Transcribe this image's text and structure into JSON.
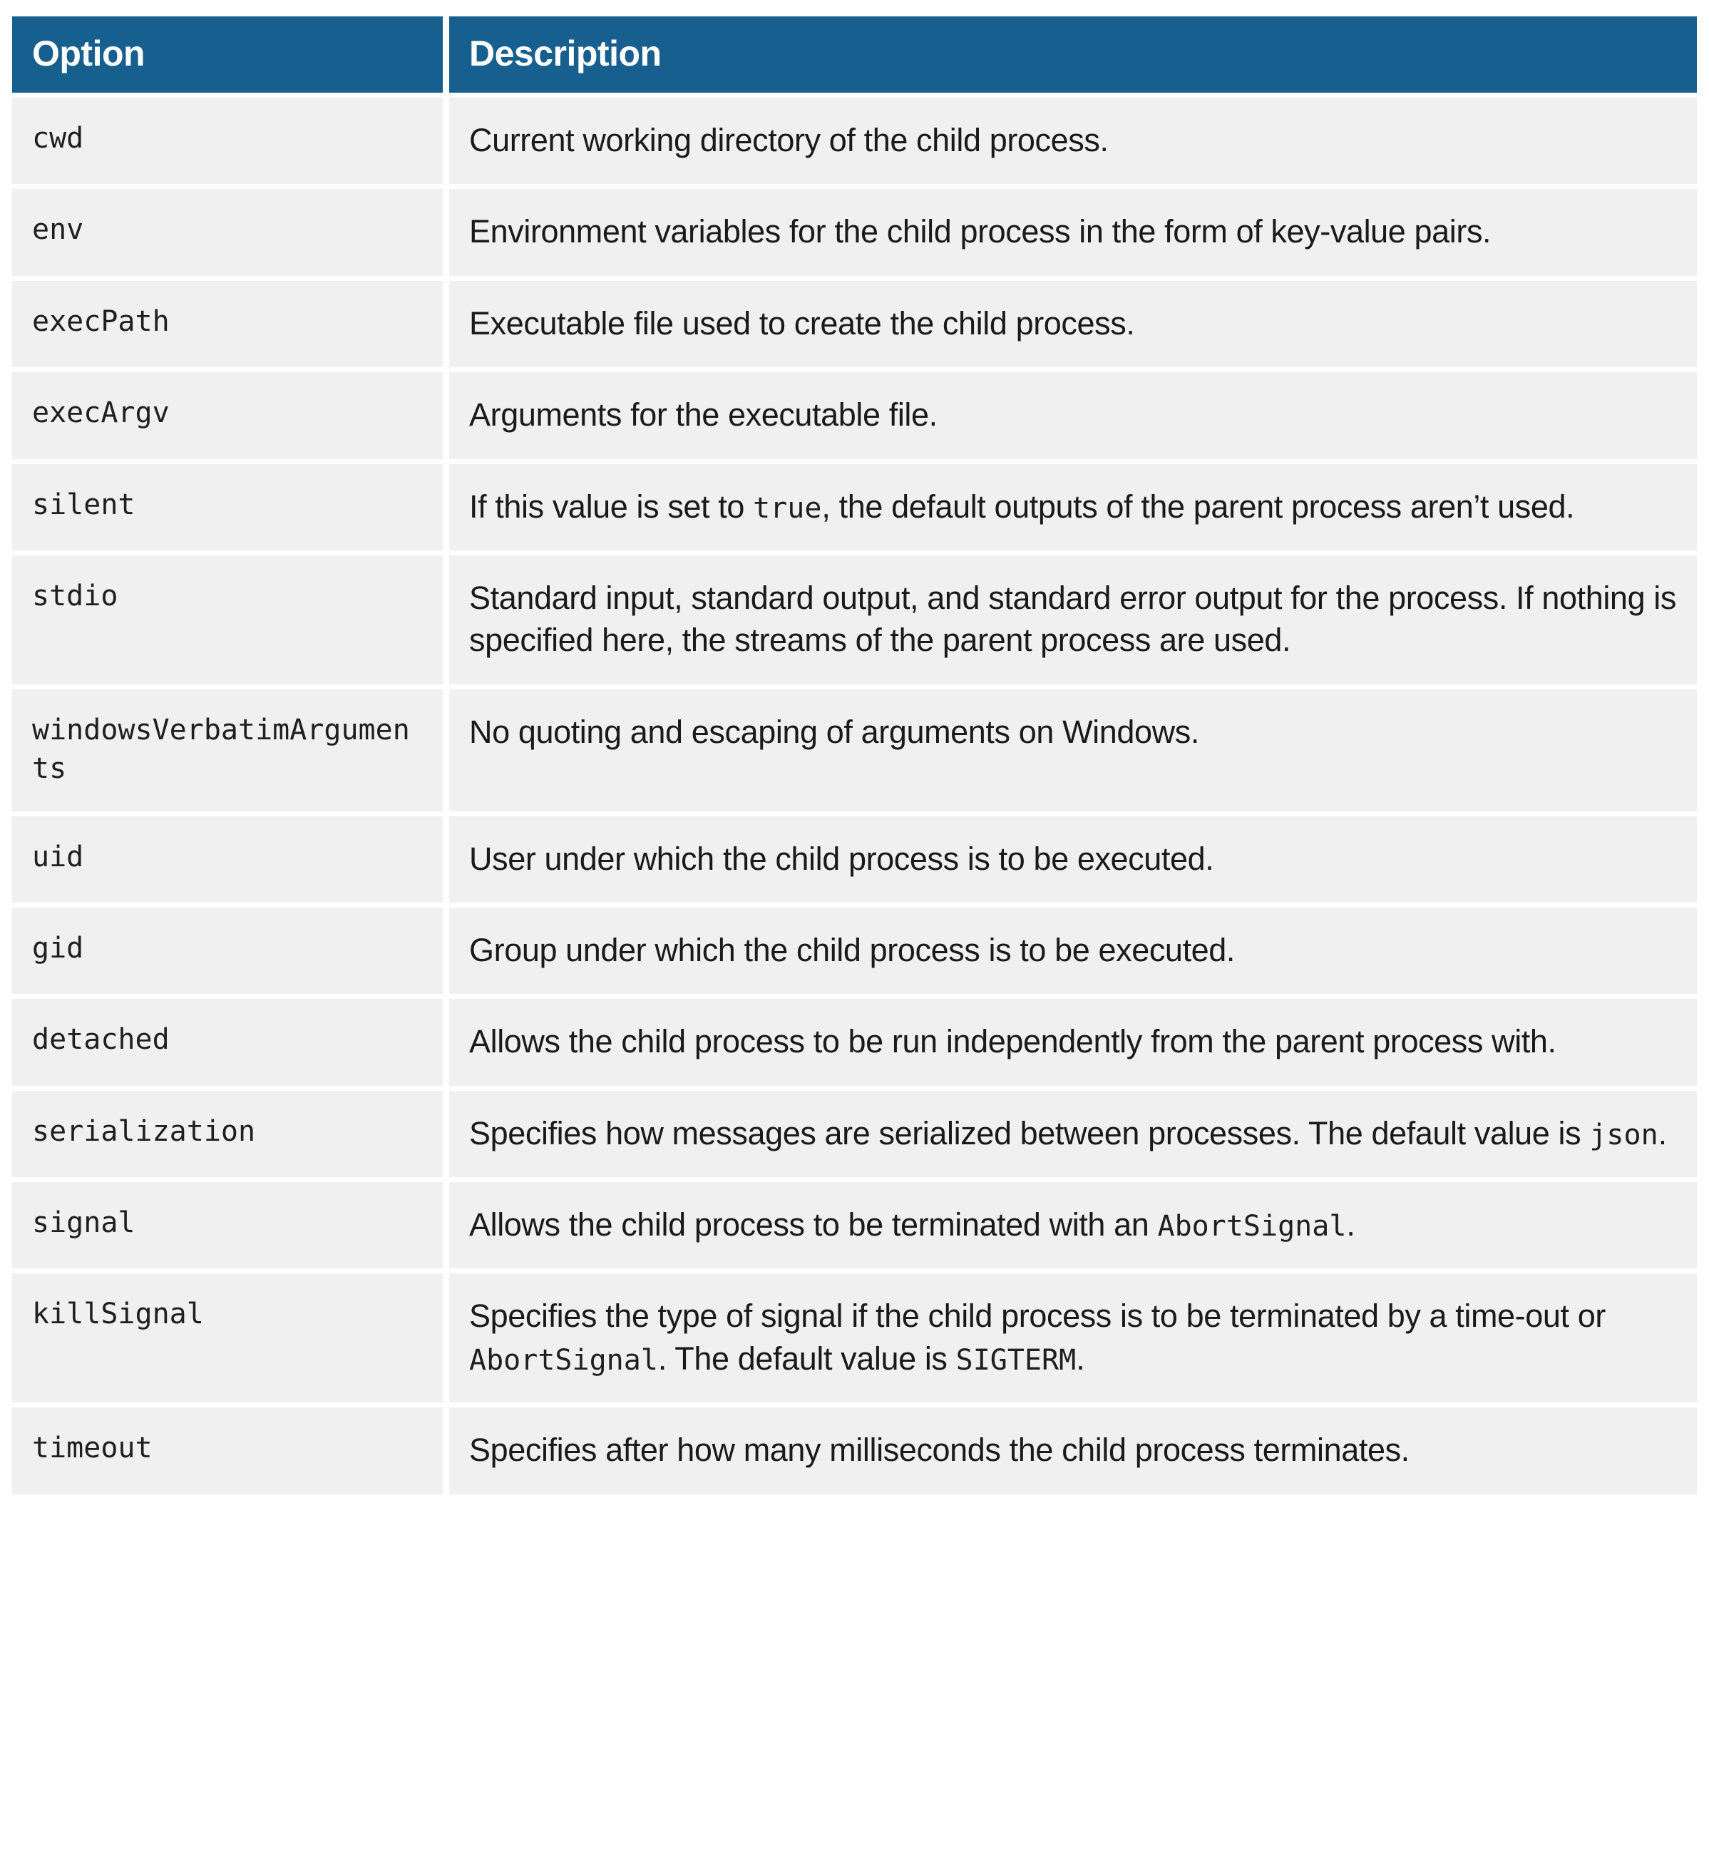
{
  "table": {
    "columns": [
      {
        "key": "option",
        "label": "Option"
      },
      {
        "key": "description",
        "label": "Description"
      }
    ],
    "header_bg": "#175f8f",
    "header_fg": "#ffffff",
    "row_bg": "#f0f0f0",
    "row_fg": "#1a1a1a",
    "rows": [
      {
        "option": "cwd",
        "description_parts": [
          {
            "type": "text",
            "value": "Current working directory of the child process."
          }
        ],
        "description": "Current working directory of the child process."
      },
      {
        "option": "env",
        "description_parts": [
          {
            "type": "text",
            "value": "Environment variables for the child process in the form of key-value pairs."
          }
        ],
        "description": "Environment variables for the child process in the form of key-value pairs."
      },
      {
        "option": "execPath",
        "description_parts": [
          {
            "type": "text",
            "value": "Executable file used to create the child process."
          }
        ],
        "description": "Executable file used to create the child process."
      },
      {
        "option": "execArgv",
        "description_parts": [
          {
            "type": "text",
            "value": "Arguments for the executable file."
          }
        ],
        "description": "Arguments for the executable file."
      },
      {
        "option": "silent",
        "description_parts": [
          {
            "type": "text",
            "value": "If this value is set to "
          },
          {
            "type": "code",
            "value": "true"
          },
          {
            "type": "text",
            "value": ", the default outputs of the parent process aren’t used."
          }
        ],
        "description": "If this value is set to true, the default outputs of the parent process aren’t used."
      },
      {
        "option": "stdio",
        "description_parts": [
          {
            "type": "text",
            "value": "Standard input, standard output, and standard error output for the process. If nothing is specified here, the streams of the parent process are used."
          }
        ],
        "description": "Standard input, standard output, and standard error output for the process. If nothing is specified here, the streams of the parent process are used."
      },
      {
        "option": "windowsVerbatimArguments",
        "description_parts": [
          {
            "type": "text",
            "value": "No quoting and escaping of arguments on Windows."
          }
        ],
        "description": "No quoting and escaping of arguments on Windows."
      },
      {
        "option": "uid",
        "description_parts": [
          {
            "type": "text",
            "value": "User under which the child process is to be executed."
          }
        ],
        "description": "User under which the child process is to be executed."
      },
      {
        "option": "gid",
        "description_parts": [
          {
            "type": "text",
            "value": "Group under which the child process is to be executed."
          }
        ],
        "description": "Group under which the child process is to be executed."
      },
      {
        "option": "detached",
        "description_parts": [
          {
            "type": "text",
            "value": "Allows the child process to be run independently from the parent process with."
          }
        ],
        "description": "Allows the child process to be run independently from the parent process with."
      },
      {
        "option": "serialization",
        "description_parts": [
          {
            "type": "text",
            "value": "Specifies how messages are serialized between processes. The default value is "
          },
          {
            "type": "code",
            "value": "json"
          },
          {
            "type": "text",
            "value": "."
          }
        ],
        "description": "Specifies how messages are serialized between processes. The default value is json."
      },
      {
        "option": "signal",
        "description_parts": [
          {
            "type": "text",
            "value": "Allows the child process to be terminated with an "
          },
          {
            "type": "code",
            "value": "AbortSignal"
          },
          {
            "type": "text",
            "value": "."
          }
        ],
        "description": "Allows the child process to be terminated with an AbortSignal."
      },
      {
        "option": "killSignal",
        "description_parts": [
          {
            "type": "text",
            "value": "Specifies the type of signal if the child process is to be terminated by a time-out or "
          },
          {
            "type": "code",
            "value": "AbortSignal"
          },
          {
            "type": "text",
            "value": ". The default value is "
          },
          {
            "type": "code",
            "value": "SIGTERM"
          },
          {
            "type": "text",
            "value": "."
          }
        ],
        "description": "Specifies the type of signal if the child process is to be terminated by a time-out or AbortSignal. The default value is SIGTERM."
      },
      {
        "option": "timeout",
        "description_parts": [
          {
            "type": "text",
            "value": "Specifies after how many milliseconds the child process terminates."
          }
        ],
        "description": "Specifies after how many milliseconds the child process terminates."
      }
    ]
  }
}
